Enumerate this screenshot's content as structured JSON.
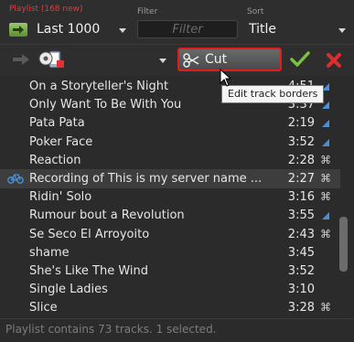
{
  "header": {
    "playlist_label": "Playlist (168 new)",
    "filter_label": "Filter",
    "sort_label": "Sort",
    "playlist_value": "Last 1000",
    "filter_placeholder": "Filter",
    "sort_value": "Title"
  },
  "toolbar": {
    "cut_label": "Cut",
    "tooltip": "Edit track borders"
  },
  "tracks": [
    {
      "title": "On a Storyteller's Night",
      "duration": "4:51",
      "mark": "triangle"
    },
    {
      "title": "Only Want To Be With You",
      "duration": "3:37",
      "mark": "triangle"
    },
    {
      "title": "Pata Pata",
      "duration": "2:19",
      "mark": "triangle"
    },
    {
      "title": "Poker Face",
      "duration": "3:52",
      "mark": "triangle"
    },
    {
      "title": "Reaction",
      "duration": "2:28",
      "mark": "cut"
    },
    {
      "title": "Recording of This is my server name ...",
      "duration": "2:27",
      "mark": "cut",
      "selected": true
    },
    {
      "title": "Ridin' Solo",
      "duration": "3:16",
      "mark": "cut"
    },
    {
      "title": "Rumour bout a Revolution",
      "duration": "3:55",
      "mark": "triangle"
    },
    {
      "title": "Se Seco El Arroyoito",
      "duration": "2:43",
      "mark": "cut"
    },
    {
      "title": "shame",
      "duration": "3:45",
      "mark": "none"
    },
    {
      "title": "She's Like The Wind",
      "duration": "3:52",
      "mark": "none"
    },
    {
      "title": "Single Ladies",
      "duration": "3:10",
      "mark": "none"
    },
    {
      "title": "Slice",
      "duration": "3:28",
      "mark": "cut"
    }
  ],
  "status": {
    "text": "Playlist contains 73 tracks. 1 selected."
  },
  "colors": {
    "accent_blue": "#4a90d9",
    "cut_border": "#e21c1c",
    "check_green": "#7cc043",
    "close_red": "#e22b2b"
  }
}
